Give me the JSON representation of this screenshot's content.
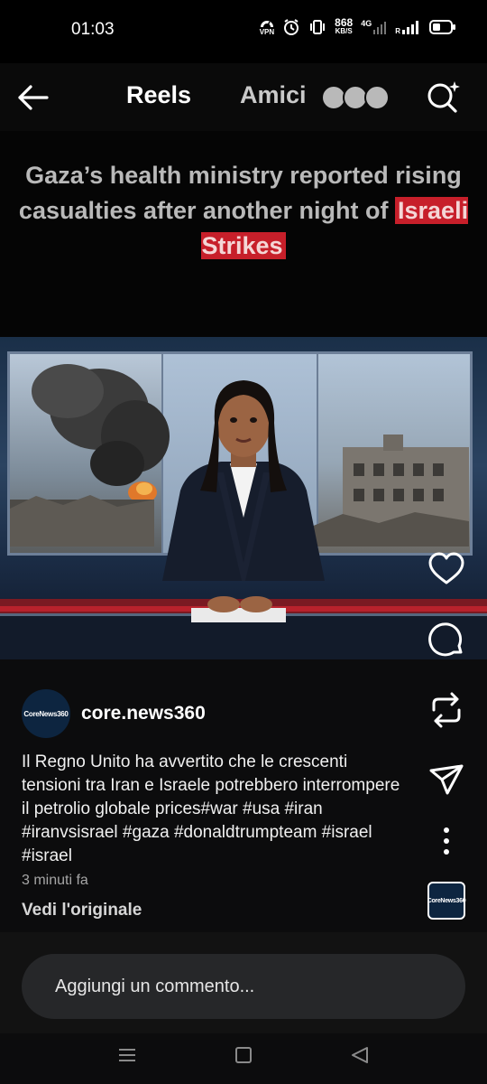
{
  "status": {
    "time": "01:03",
    "vpn": "VPN",
    "speed_value": "868",
    "speed_unit": "KB/S",
    "network": "4G",
    "roaming": "R"
  },
  "header": {
    "title": "Reels",
    "friends_label": "Amici"
  },
  "reel": {
    "headline_prefix": "Gaza’s health ministry reported rising casualties after another night of",
    "headline_highlight": "Israeli Strikes"
  },
  "account": {
    "avatar_text": "CoreNews360",
    "username": "core.news360"
  },
  "post": {
    "caption": "Il Regno Unito ha avvertito che le crescenti tensioni tra Iran e Israele potrebbero interrompere il petrolio globale prices#war #usa #iran #iranvsisrael #gaza #donaldtrumpteam #israel #israel",
    "time_ago": "3 minuti fa",
    "see_original": "Vedi l'originale"
  },
  "audio": {
    "thumb_text": "CoreNews360"
  },
  "comment": {
    "placeholder": "Aggiungi un commento..."
  },
  "icons": {
    "back": "arrow-left-icon",
    "search": "search-sparkle-icon",
    "like": "heart-icon",
    "comment": "comment-bubble-icon",
    "repost": "repost-icon",
    "share": "send-icon",
    "more": "more-vertical-icon",
    "nav_recents": "menu-lines-icon",
    "nav_home": "square-icon",
    "nav_back": "triangle-back-icon"
  },
  "colors": {
    "highlight_red": "#c71f2a",
    "background": "#0c0c0d",
    "input_bg": "#262729"
  }
}
